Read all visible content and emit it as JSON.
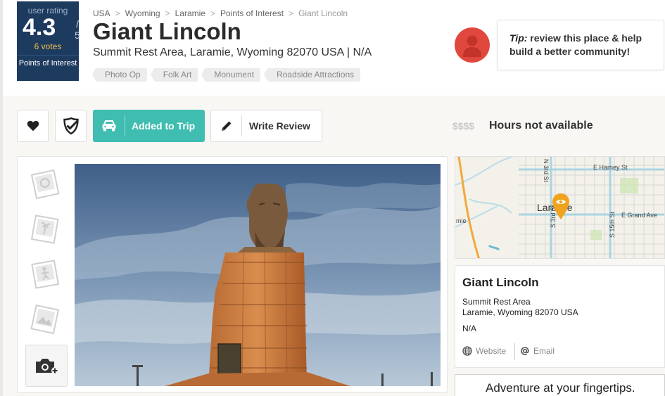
{
  "rating": {
    "label": "user rating",
    "score": "4.3",
    "max": "/ 5",
    "votes": "6 votes",
    "category": "Points of Interest"
  },
  "breadcrumb": {
    "items": [
      "USA",
      "Wyoming",
      "Laramie",
      "Points of Interest"
    ],
    "current": "Giant Lincoln",
    "separator": ">"
  },
  "place": {
    "title": "Giant Lincoln",
    "address_line": "Summit Rest Area, Laramie, Wyoming 82070 USA | N/A"
  },
  "tags": [
    "Photo Op",
    "Folk Art",
    "Monument",
    "Roadside Attractions"
  ],
  "tip": {
    "prefix": "Tip:",
    "text": "review this place & help build a better community!"
  },
  "actions": {
    "trip_label": "Added to Trip",
    "review_label": "Write Review"
  },
  "price": "$$$$",
  "hours": "Hours not available",
  "map": {
    "city_label": "Laramie",
    "streets": [
      "E Harney St",
      "N 3rd St",
      "E Grand Ave",
      "S 3rd St",
      "S 15th St",
      "mie"
    ]
  },
  "info": {
    "name": "Giant Lincoln",
    "address1": "Summit Rest Area",
    "address2": "Laramie, Wyoming 82070 USA",
    "phone": "N/A",
    "website_label": "Website",
    "email_label": "Email"
  },
  "promo": {
    "text": "Adventure at your fingertips."
  },
  "colors": {
    "rating_bg": "#1d3a5f",
    "votes": "#f2c24b",
    "trip_button": "#3fbdb0",
    "avatar": "#e0483d",
    "map_pin": "#f0a31e"
  },
  "icons": {
    "heart": "heart-icon",
    "check": "checkmark-shield-icon",
    "car": "car-icon",
    "pencil": "pencil-icon",
    "camera": "camera-add-icon",
    "globe": "globe-icon",
    "at": "at-sign-icon"
  }
}
